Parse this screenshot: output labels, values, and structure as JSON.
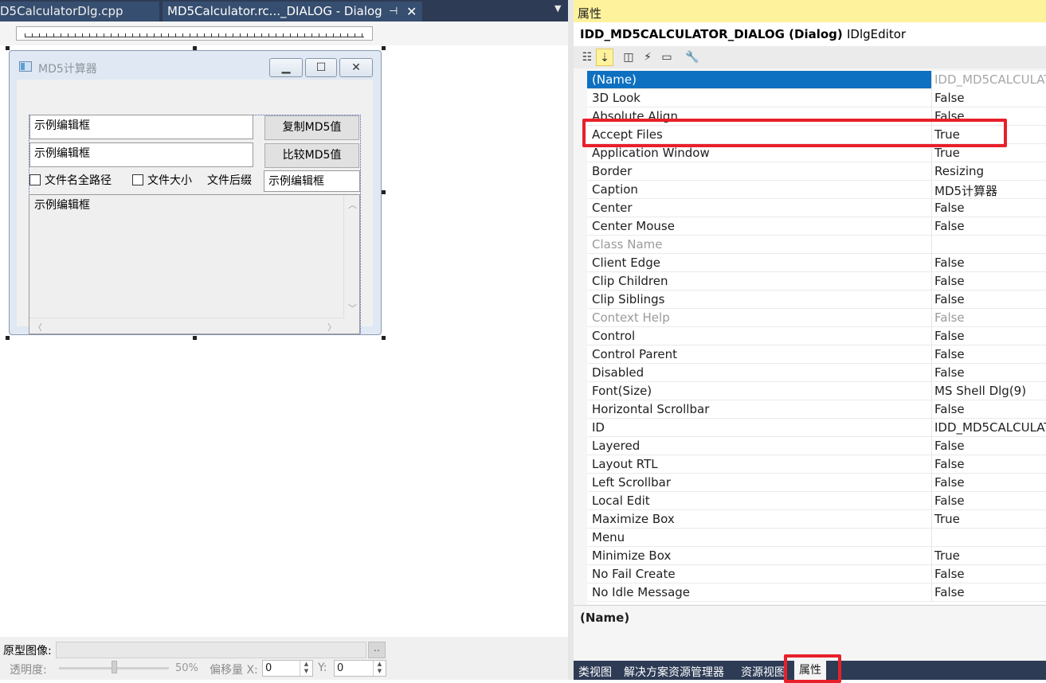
{
  "editor": {
    "tabs": [
      {
        "label": "D5CalculatorDlg.cpp"
      },
      {
        "label": "MD5Calculator.rc..._DIALOG - Dialog"
      }
    ]
  },
  "dialog": {
    "title": "MD5计算器",
    "edit1": "示例编辑框",
    "edit2": "示例编辑框",
    "copy_button": "复制MD5值",
    "compare_button": "比较MD5值",
    "checkbox_fullpath": "文件名全路径",
    "checkbox_size": "文件大小",
    "suffix_label": "文件后缀",
    "suffix_edit": "示例编辑框",
    "memo": "示例编辑框"
  },
  "bottom": {
    "proto_label": "原型图像:",
    "proto_browse": "..",
    "opacity_label": "透明度:",
    "opacity_value": "50%",
    "opacity_fraction": 0.5,
    "offset_label": "偏移量 X:",
    "x_value": "0",
    "y_label": "Y:",
    "y_value": "0"
  },
  "properties": {
    "header": "属性",
    "object_name": "IDD_MD5CALCULATOR_DIALOG (Dialog)",
    "object_type": "IDlgEditor",
    "rows": [
      {
        "name": "(Name)",
        "value": "IDD_MD5CALCULAT"
      },
      {
        "name": "3D Look",
        "value": "False"
      },
      {
        "name": "Absolute Align",
        "value": "False"
      },
      {
        "name": "Accept Files",
        "value": "True"
      },
      {
        "name": "Application Window",
        "value": "True"
      },
      {
        "name": "Border",
        "value": "Resizing"
      },
      {
        "name": "Caption",
        "value": "MD5计算器"
      },
      {
        "name": "Center",
        "value": "False"
      },
      {
        "name": "Center Mouse",
        "value": "False"
      },
      {
        "name": "Class Name",
        "value": ""
      },
      {
        "name": "Client Edge",
        "value": "False"
      },
      {
        "name": "Clip Children",
        "value": "False"
      },
      {
        "name": "Clip Siblings",
        "value": "False"
      },
      {
        "name": "Context Help",
        "value": "False"
      },
      {
        "name": "Control",
        "value": "False"
      },
      {
        "name": "Control Parent",
        "value": "False"
      },
      {
        "name": "Disabled",
        "value": "False"
      },
      {
        "name": "Font(Size)",
        "value": "MS Shell Dlg(9)"
      },
      {
        "name": "Horizontal Scrollbar",
        "value": "False"
      },
      {
        "name": "ID",
        "value": "IDD_MD5CALCULAT"
      },
      {
        "name": "Layered",
        "value": "False"
      },
      {
        "name": "Layout RTL",
        "value": "False"
      },
      {
        "name": "Left Scrollbar",
        "value": "False"
      },
      {
        "name": "Local Edit",
        "value": "False"
      },
      {
        "name": "Maximize Box",
        "value": "True"
      },
      {
        "name": "Menu",
        "value": ""
      },
      {
        "name": "Minimize Box",
        "value": "True"
      },
      {
        "name": "No Fail Create",
        "value": "False"
      },
      {
        "name": "No Idle Message",
        "value": "False"
      }
    ],
    "description_name": "(Name)"
  },
  "bottom_tabs": [
    {
      "label": "类视图"
    },
    {
      "label": "解决方案资源管理器"
    },
    {
      "label": "资源视图"
    },
    {
      "label": "属性"
    }
  ],
  "colors": {
    "selection": "#0e70c0",
    "highlight_box": "#e8202a",
    "header_accent": "#fff29d"
  }
}
